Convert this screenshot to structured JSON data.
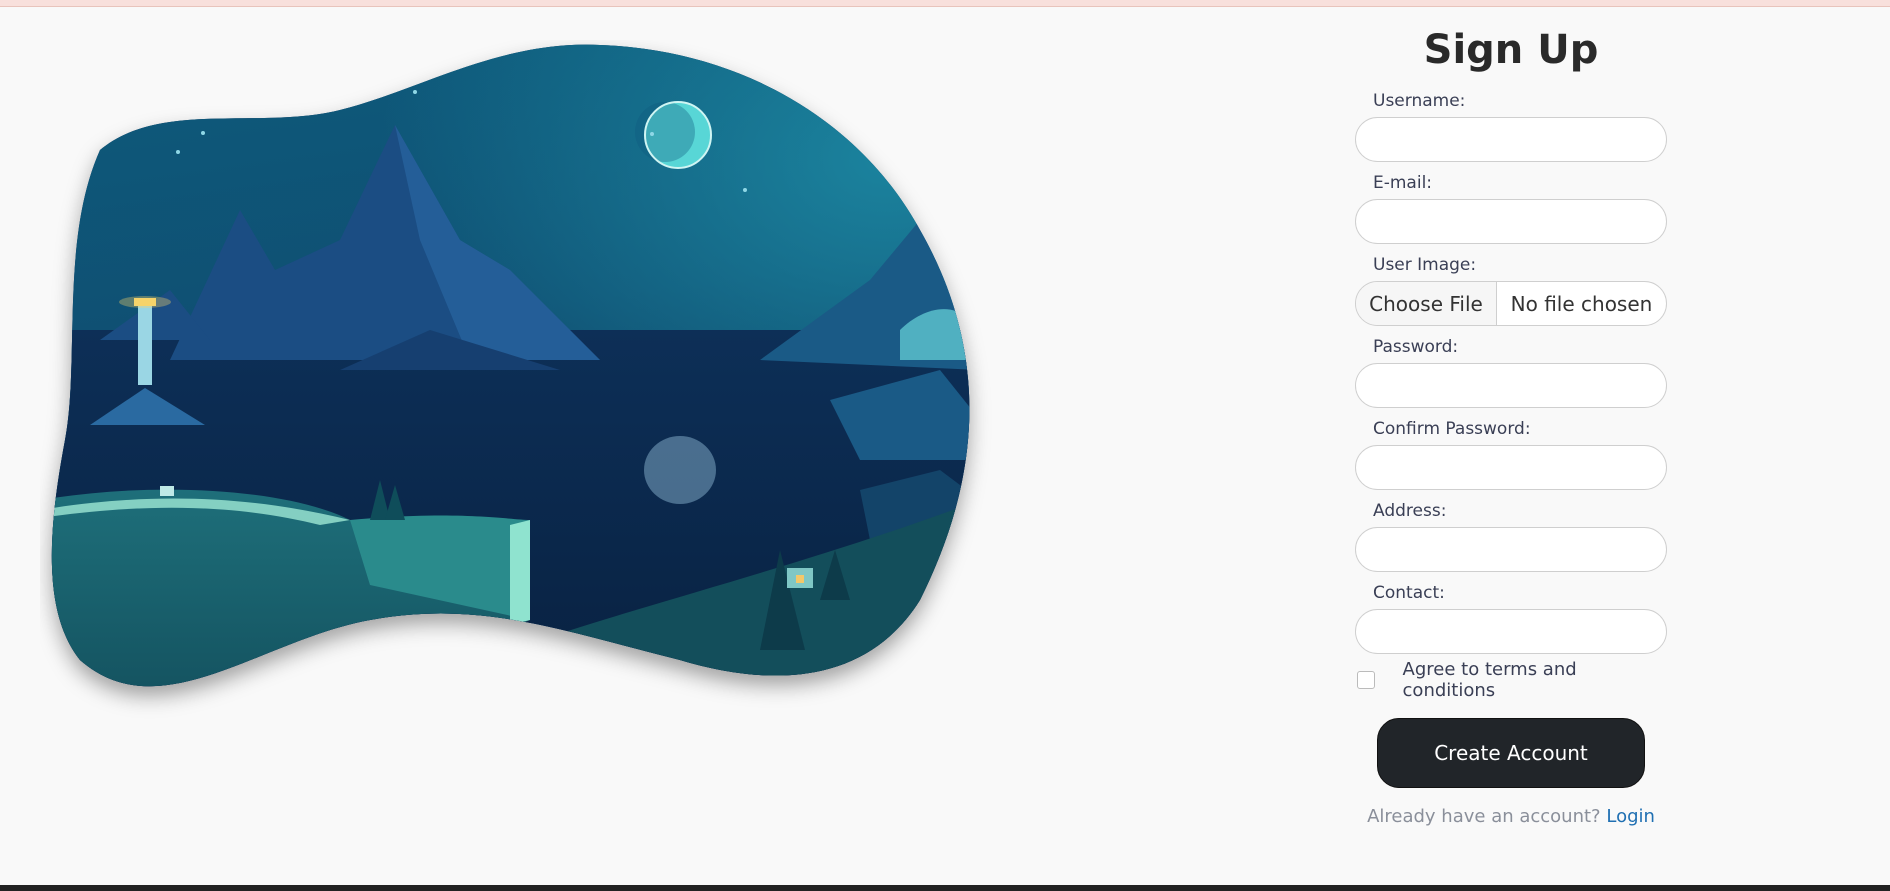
{
  "title": "Sign Up",
  "fields": {
    "username": {
      "label": "Username:",
      "value": ""
    },
    "email": {
      "label": "E-mail:",
      "value": ""
    },
    "image": {
      "label": "User Image:",
      "button": "Choose File",
      "status": "No file chosen"
    },
    "password": {
      "label": "Password:",
      "value": ""
    },
    "confirm": {
      "label": "Confirm Password:",
      "value": ""
    },
    "address": {
      "label": "Address:",
      "value": ""
    },
    "contact": {
      "label": "Contact:",
      "value": ""
    }
  },
  "agree": {
    "label": "Agree to terms and conditions",
    "checked": false
  },
  "create_label": "Create Account",
  "already_text": "Already have an account?",
  "login_label": "Login",
  "colors": {
    "primary_button": "#212529",
    "link": "#1f6fb2",
    "top_bar": "#f8e0dc"
  }
}
